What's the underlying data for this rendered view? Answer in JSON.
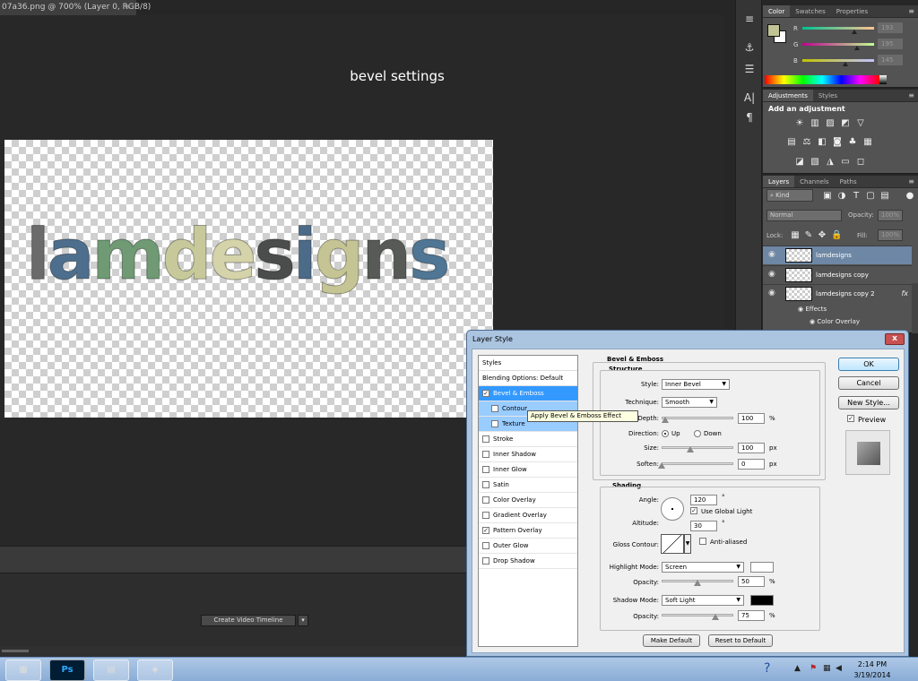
{
  "window": {
    "doc_tab": "07a36.png @ 700% (Layer 0, RGB/8)",
    "doc_close": "×"
  },
  "document": {
    "overlay_label": "bevel settings",
    "art_letters": [
      {
        "ch": "l",
        "color": "#6b6b6b"
      },
      {
        "ch": "a",
        "color": "#4d6f8d"
      },
      {
        "ch": "m",
        "color": "#6f9a74"
      },
      {
        "ch": "d",
        "color": "#c7c99b"
      },
      {
        "ch": "e",
        "color": "#d4d3a9"
      },
      {
        "ch": "s",
        "color": "#4a4d4b"
      },
      {
        "ch": "i",
        "color": "#4c6b88"
      },
      {
        "ch": "g",
        "color": "#c5c494"
      },
      {
        "ch": "n",
        "color": "#575a56"
      },
      {
        "ch": "s",
        "color": "#4f7694"
      }
    ]
  },
  "timeline": {
    "create_button": "Create Video Timeline",
    "dropdown": "▾"
  },
  "tool_strip": {
    "icons": [
      "tools-icon",
      "brush-icon",
      "sliders-icon",
      "character-icon",
      "paragraph-icon"
    ],
    "glyphs": [
      "≡",
      "⚓",
      "☰",
      "A|",
      "¶"
    ]
  },
  "color_panel": {
    "tabs": [
      "Color",
      "Swatches",
      "Properties"
    ],
    "menu": "≡",
    "foreground": "#c1c595",
    "sliders": [
      {
        "label": "R",
        "value": "193"
      },
      {
        "label": "G",
        "value": "195"
      },
      {
        "label": "B",
        "value": "145"
      }
    ]
  },
  "adjustments_panel": {
    "tabs": [
      "Adjustments",
      "Styles"
    ],
    "menu": "≡",
    "heading": "Add an adjustment"
  },
  "layers_panel": {
    "tabs": [
      "Layers",
      "Channels",
      "Paths"
    ],
    "menu": "≡",
    "kind_filter": "⌕ Kind",
    "blend_mode": "Normal",
    "opacity_label": "Opacity:",
    "opacity_value": "100%",
    "lock_label": "Lock:",
    "fill_label": "Fill:",
    "fill_value": "100%",
    "layers": [
      {
        "name": "lamdesigns",
        "selected": true,
        "fx": ""
      },
      {
        "name": "lamdesigns copy",
        "selected": false,
        "fx": ""
      },
      {
        "name": "lamdesigns copy 2",
        "selected": false,
        "fx": "fx"
      }
    ],
    "effects_label": "Effects",
    "effect_item": "Color Overlay"
  },
  "dialog": {
    "title": "Layer Style",
    "styles_header": "Styles",
    "blending_options": "Blending Options: Default",
    "items": [
      {
        "label": "Bevel & Emboss",
        "checked": true,
        "state": "selected"
      },
      {
        "label": "Contour",
        "checked": false,
        "state": "sub"
      },
      {
        "label": "Texture",
        "checked": false,
        "state": "sub"
      },
      {
        "label": "Stroke",
        "checked": false,
        "state": ""
      },
      {
        "label": "Inner Shadow",
        "checked": false,
        "state": ""
      },
      {
        "label": "Inner Glow",
        "checked": false,
        "state": ""
      },
      {
        "label": "Satin",
        "checked": false,
        "state": ""
      },
      {
        "label": "Color Overlay",
        "checked": false,
        "state": ""
      },
      {
        "label": "Gradient Overlay",
        "checked": false,
        "state": ""
      },
      {
        "label": "Pattern Overlay",
        "checked": true,
        "state": ""
      },
      {
        "label": "Outer Glow",
        "checked": false,
        "state": ""
      },
      {
        "label": "Drop Shadow",
        "checked": false,
        "state": ""
      }
    ],
    "tooltip": "Apply Bevel & Emboss Effect",
    "bevel": {
      "title": "Bevel & Emboss",
      "structure_title": "Structure",
      "style_label": "Style:",
      "style_value": "Inner Bevel",
      "technique_label": "Technique:",
      "technique_value": "Smooth",
      "depth_label": "Depth:",
      "depth_value": "100",
      "depth_unit": "%",
      "depth_level": 0.05,
      "direction_label": "Direction:",
      "direction_up": "Up",
      "direction_down": "Down",
      "size_label": "Size:",
      "size_value": "100",
      "size_unit": "px",
      "size_level": 0.4,
      "soften_label": "Soften:",
      "soften_value": "0",
      "soften_unit": "px",
      "soften_level": 0.0
    },
    "shading": {
      "title": "Shading",
      "angle_label": "Angle:",
      "angle_value": "120",
      "angle_unit": "°",
      "global_light": "Use Global Light",
      "altitude_label": "Altitude:",
      "altitude_value": "30",
      "altitude_unit": "°",
      "gloss_label": "Gloss Contour:",
      "anti_aliased": "Anti-aliased",
      "highlight_label": "Highlight Mode:",
      "highlight_value": "Screen",
      "highlight_color": "#ffffff",
      "hl_opacity_label": "Opacity:",
      "hl_opacity_value": "50",
      "hl_opacity_level": 0.5,
      "shadow_label": "Shadow Mode:",
      "shadow_value": "Soft Light",
      "shadow_color": "#000000",
      "sh_opacity_label": "Opacity:",
      "sh_opacity_value": "75",
      "sh_opacity_level": 0.75,
      "percent": "%"
    },
    "make_default": "Make Default",
    "reset_default": "Reset to Default",
    "ok": "OK",
    "cancel": "Cancel",
    "new_style": "New Style...",
    "preview": "Preview",
    "close": "x"
  },
  "taskbar": {
    "time": "2:14 PM",
    "date": "3/19/2014",
    "ps_label": "Ps"
  }
}
